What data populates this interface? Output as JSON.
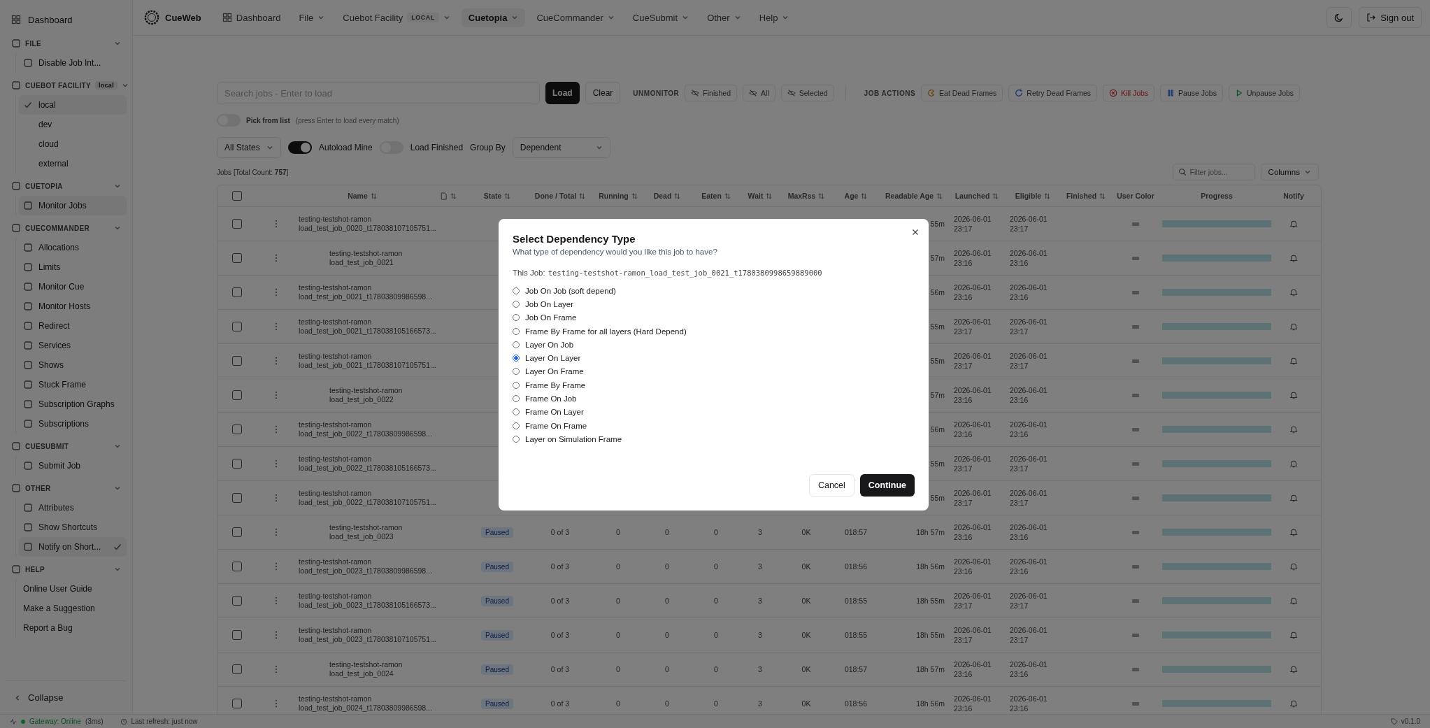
{
  "sidebar": {
    "dashboard": "Dashboard",
    "sections": [
      {
        "title": "FILE",
        "expanded": true,
        "items": [
          {
            "label": "Disable Job Int...",
            "kind": "icon",
            "selected": false,
            "checked": false
          }
        ]
      },
      {
        "title": "CUEBOT FACILITY",
        "badge": "local",
        "expanded": true,
        "items": [
          {
            "label": "local",
            "kind": "plain",
            "selected": true,
            "checked": true
          },
          {
            "label": "dev",
            "kind": "plain",
            "selected": false,
            "checked": false
          },
          {
            "label": "cloud",
            "kind": "plain",
            "selected": false,
            "checked": false
          },
          {
            "label": "external",
            "kind": "plain",
            "selected": false,
            "checked": false
          }
        ]
      },
      {
        "title": "CUETOPIA",
        "expanded": true,
        "items": [
          {
            "label": "Monitor Jobs",
            "kind": "icon",
            "selected": true,
            "checked": false
          }
        ]
      },
      {
        "title": "CUECOMMANDER",
        "expanded": true,
        "items": [
          {
            "label": "Allocations",
            "kind": "icon",
            "selected": false,
            "checked": false
          },
          {
            "label": "Limits",
            "kind": "icon",
            "selected": false,
            "checked": false
          },
          {
            "label": "Monitor Cue",
            "kind": "icon",
            "selected": false,
            "checked": false
          },
          {
            "label": "Monitor Hosts",
            "kind": "icon",
            "selected": false,
            "checked": false
          },
          {
            "label": "Redirect",
            "kind": "icon",
            "selected": false,
            "checked": false
          },
          {
            "label": "Services",
            "kind": "icon",
            "selected": false,
            "checked": false
          },
          {
            "label": "Shows",
            "kind": "icon",
            "selected": false,
            "checked": false
          },
          {
            "label": "Stuck Frame",
            "kind": "icon",
            "selected": false,
            "checked": false
          },
          {
            "label": "Subscription Graphs",
            "kind": "icon",
            "selected": false,
            "checked": false
          },
          {
            "label": "Subscriptions",
            "kind": "icon",
            "selected": false,
            "checked": false
          }
        ]
      },
      {
        "title": "CUESUBMIT",
        "expanded": true,
        "items": [
          {
            "label": "Submit Job",
            "kind": "icon",
            "selected": false,
            "checked": false
          }
        ]
      },
      {
        "title": "OTHER",
        "expanded": true,
        "items": [
          {
            "label": "Attributes",
            "kind": "icon",
            "selected": false,
            "checked": false
          },
          {
            "label": "Show Shortcuts",
            "kind": "icon",
            "selected": false,
            "checked": false
          },
          {
            "label": "Notify on Short...",
            "kind": "icon",
            "selected": true,
            "checked": true
          }
        ]
      },
      {
        "title": "HELP",
        "expanded": true,
        "items": [
          {
            "label": "Online User Guide",
            "kind": "text",
            "selected": false,
            "checked": false
          },
          {
            "label": "Make a Suggestion",
            "kind": "text",
            "selected": false,
            "checked": false
          },
          {
            "label": "Report a Bug",
            "kind": "text",
            "selected": false,
            "checked": false
          }
        ]
      }
    ],
    "collapse": "Collapse"
  },
  "nav": {
    "brand": "CueWeb",
    "menus": [
      {
        "label": "Dashboard",
        "kind": "link",
        "selected": false
      },
      {
        "label": "File",
        "kind": "menu",
        "selected": false
      },
      {
        "label": "Cuebot Facility",
        "kind": "menu",
        "badge": "LOCAL",
        "selected": false
      },
      {
        "label": "Cuetopia",
        "kind": "menu",
        "selected": true
      },
      {
        "label": "CueCommander",
        "kind": "menu",
        "selected": false
      },
      {
        "label": "CueSubmit",
        "kind": "menu",
        "selected": false
      },
      {
        "label": "Other",
        "kind": "menu",
        "selected": false
      },
      {
        "label": "Help",
        "kind": "menu",
        "selected": false
      }
    ],
    "sign_out": "Sign out"
  },
  "toolbar": {
    "search": {
      "placeholder": "Search jobs - Enter to load"
    },
    "load": "Load",
    "clear": "Clear",
    "unmonitor": {
      "label": "UNMONITOR",
      "buttons": [
        "Finished",
        "All",
        "Selected"
      ]
    },
    "job_actions": {
      "label": "JOB ACTIONS",
      "buttons": [
        {
          "label": "Eat Dead Frames",
          "kind": "eat"
        },
        {
          "label": "Retry Dead Frames",
          "kind": "retry"
        },
        {
          "label": "Kill Jobs",
          "kind": "kill"
        },
        {
          "label": "Pause Jobs",
          "kind": "pause"
        },
        {
          "label": "Unpause Jobs",
          "kind": "unpause"
        }
      ]
    }
  },
  "pick_from_list": {
    "on": false,
    "label": "Pick from list",
    "hint": "(press Enter to load every match)"
  },
  "filters": {
    "state": "All States",
    "autoload_mine": {
      "label": "Autoload Mine",
      "on": true
    },
    "load_finished": {
      "label": "Load Finished",
      "on": false
    },
    "group_by_label": "Group By",
    "group_by": "Dependent"
  },
  "jobs_count": "Jobs [Total Count: **757**]",
  "table_tools": {
    "filter": {
      "placeholder": "Filter jobs..."
    },
    "columns": "Columns"
  },
  "table": {
    "all_checked": false,
    "columns": [
      {
        "label": "Name",
        "sortable": true
      },
      {
        "sortable": true
      },
      {
        "label": "State",
        "sortable": true
      },
      {
        "label": "Done / Total",
        "sortable": true
      },
      {
        "label": "Running",
        "sortable": true
      },
      {
        "label": "Dead",
        "sortable": true
      },
      {
        "label": "Eaten",
        "sortable": true
      },
      {
        "label": "Wait",
        "sortable": true
      },
      {
        "label": "MaxRss",
        "sortable": true
      },
      {
        "label": "Age",
        "sortable": true
      },
      {
        "label": "Readable Age",
        "sortable": true
      },
      {
        "label": "Launched",
        "sortable": true
      },
      {
        "label": "Eligible",
        "sortable": true
      },
      {
        "label": "Finished",
        "sortable": true
      },
      {
        "label": "User Color",
        "sortable": false
      },
      {
        "label": "Progress",
        "sortable": false
      },
      {
        "label": "Notify",
        "sortable": false
      }
    ],
    "rows": [
      {
        "kind": "job",
        "name": [
          "testing-testshot-ramon",
          "load_test_job_0020_t178038107105751..."
        ],
        "checked": false,
        "level": 1,
        "readable_age": "55m",
        "launched": "2026-06-01 23:17",
        "eligible": "2026-06-01 23:17"
      },
      {
        "kind": "group",
        "name": [
          "testing-testshot-ramon",
          "load_test_job_0021"
        ],
        "checked": false,
        "level": 1,
        "readable_age": "57m",
        "launched": "2026-06-01 23:16",
        "eligible": "2026-06-01 23:16"
      },
      {
        "kind": "job",
        "name": [
          "testing-testshot-ramon",
          "load_test_job_0021_t17803809986598..."
        ],
        "checked": false,
        "level": 1,
        "readable_age": "56m",
        "launched": "2026-06-01 23:16",
        "eligible": "2026-06-01 23:16"
      },
      {
        "kind": "job",
        "name": [
          "testing-testshot-ramon",
          "load_test_job_0021_t178038105166573..."
        ],
        "checked": false,
        "level": 1,
        "readable_age": "55m",
        "launched": "2026-06-01 23:17",
        "eligible": "2026-06-01 23:17"
      },
      {
        "kind": "job",
        "name": [
          "testing-testshot-ramon",
          "load_test_job_0021_t178038107105751..."
        ],
        "checked": false,
        "level": 1,
        "readable_age": "55m",
        "launched": "2026-06-01 23:17",
        "eligible": "2026-06-01 23:17"
      },
      {
        "kind": "group",
        "name": [
          "testing-testshot-ramon",
          "load_test_job_0022"
        ],
        "checked": false,
        "level": 1,
        "readable_age": "57m",
        "launched": "2026-06-01 23:16",
        "eligible": "2026-06-01 23:16"
      },
      {
        "kind": "job",
        "name": [
          "testing-testshot-ramon",
          "load_test_job_0022_t17803809986598..."
        ],
        "checked": false,
        "level": 1,
        "readable_age": "56m",
        "launched": "2026-06-01 23:16",
        "eligible": "2026-06-01 23:16"
      },
      {
        "kind": "job",
        "name": [
          "testing-testshot-ramon",
          "load_test_job_0022_t178038105166573..."
        ],
        "checked": false,
        "level": 1,
        "readable_age": "55m",
        "launched": "2026-06-01 23:17",
        "eligible": "2026-06-01 23:17"
      },
      {
        "kind": "job",
        "name": [
          "testing-testshot-ramon",
          "load_test_job_0022_t178038107105751..."
        ],
        "checked": false,
        "level": 1,
        "readable_age": "55m",
        "launched": "2026-06-01 23:17",
        "eligible": "2026-06-01 23:17"
      },
      {
        "kind": "group",
        "name": [
          "testing-testshot-ramon",
          "load_test_job_0023"
        ],
        "checked": false,
        "level": 1,
        "state": "Paused",
        "done_total": "0 of 3",
        "running": "0",
        "dead": "0",
        "eaten": "0",
        "wait": "3",
        "maxrss": "0K",
        "age": "018:57",
        "readable_age": "18h 57m",
        "launched": "2026-06-01 23:16",
        "eligible": "2026-06-01 23:16"
      },
      {
        "kind": "job",
        "name": [
          "testing-testshot-ramon",
          "load_test_job_0023_t17803809986598..."
        ],
        "checked": false,
        "level": 1,
        "state": "Paused",
        "done_total": "0 of 3",
        "running": "0",
        "dead": "0",
        "eaten": "0",
        "wait": "3",
        "maxrss": "0K",
        "age": "018:56",
        "readable_age": "18h 56m",
        "launched": "2026-06-01 23:16",
        "eligible": "2026-06-01 23:16"
      },
      {
        "kind": "job",
        "name": [
          "testing-testshot-ramon",
          "load_test_job_0023_t178038105166573..."
        ],
        "checked": false,
        "level": 1,
        "state": "Paused",
        "done_total": "0 of 3",
        "running": "0",
        "dead": "0",
        "eaten": "0",
        "wait": "3",
        "maxrss": "0K",
        "age": "018:55",
        "readable_age": "18h 55m",
        "launched": "2026-06-01 23:17",
        "eligible": "2026-06-01 23:17"
      },
      {
        "kind": "job",
        "name": [
          "testing-testshot-ramon",
          "load_test_job_0023_t178038107105751..."
        ],
        "checked": false,
        "level": 1,
        "state": "Paused",
        "done_total": "0 of 3",
        "running": "0",
        "dead": "0",
        "eaten": "0",
        "wait": "3",
        "maxrss": "0K",
        "age": "018:55",
        "readable_age": "18h 55m",
        "launched": "2026-06-01 23:17",
        "eligible": "2026-06-01 23:17"
      },
      {
        "kind": "group",
        "name": [
          "testing-testshot-ramon",
          "load_test_job_0024"
        ],
        "checked": false,
        "level": 1,
        "state": "Paused",
        "done_total": "0 of 3",
        "running": "0",
        "dead": "0",
        "eaten": "0",
        "wait": "3",
        "maxrss": "0K",
        "age": "018:57",
        "readable_age": "18h 57m",
        "launched": "2026-06-01 23:16",
        "eligible": "2026-06-01 23:16"
      },
      {
        "kind": "job",
        "name": [
          "testing-testshot-ramon",
          "load_test_job_0024_t17803809986598..."
        ],
        "checked": false,
        "level": 1,
        "state": "Paused",
        "done_total": "0 of 3",
        "running": "0",
        "dead": "0",
        "eaten": "0",
        "wait": "3",
        "maxrss": "0K",
        "age": "018:56",
        "readable_age": "18h 56m",
        "launched": "2026-06-01 23:16",
        "eligible": "2026-06-01 23:16"
      }
    ]
  },
  "status_bar": {
    "gateway": "Gateway: Online",
    "latency": "(3ms)",
    "refresh": "Last refresh: just now",
    "version": "v0.1.0"
  },
  "dialog": {
    "title": "Select Dependency Type",
    "subtitle": "What type of dependency would you like this job to have?",
    "job_label": "This Job:",
    "job_name": "testing-testshot-ramon_load_test_job_0021_t1780380998659889000",
    "options": [
      {
        "label": "Job On Job (soft depend)",
        "selected": false
      },
      {
        "label": "Job On Layer",
        "selected": false
      },
      {
        "label": "Job On Frame",
        "selected": false
      },
      {
        "label": "Frame By Frame for all layers (Hard Depend)",
        "selected": false
      },
      {
        "label": "Layer On Job",
        "selected": false
      },
      {
        "label": "Layer On Layer",
        "selected": true
      },
      {
        "label": "Layer On Frame",
        "selected": false
      },
      {
        "label": "Frame By Frame",
        "selected": false
      },
      {
        "label": "Frame On Job",
        "selected": false
      },
      {
        "label": "Frame On Layer",
        "selected": false
      },
      {
        "label": "Frame On Frame",
        "selected": false
      },
      {
        "label": "Layer on Simulation Frame",
        "selected": false
      }
    ],
    "cancel": "Cancel",
    "continue": "Continue"
  }
}
